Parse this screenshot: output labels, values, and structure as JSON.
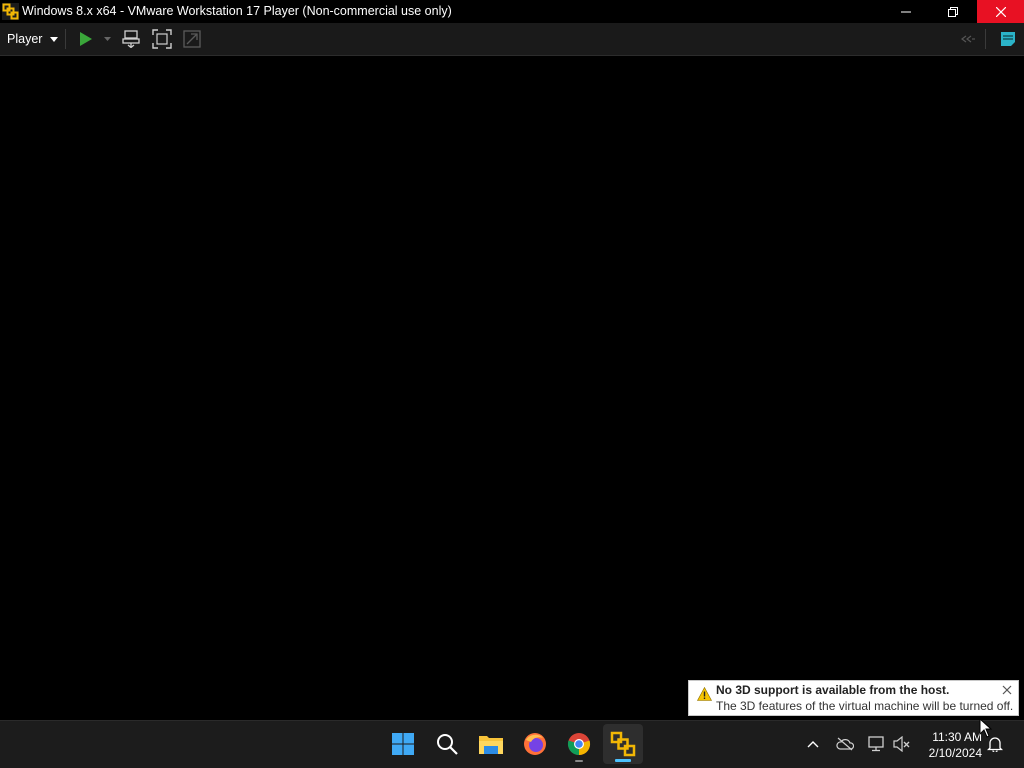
{
  "window": {
    "title": "Windows 8.x x64 - VMware Workstation 17 Player (Non-commercial use only)"
  },
  "toolbar": {
    "player_menu": "Player",
    "icons": [
      "play-icon",
      "play-dropdown-icon",
      "send-ctrl-alt-del-icon",
      "full-screen-icon",
      "unity-icon",
      "collapse-toolbar-icon",
      "message-log-icon"
    ]
  },
  "notification": {
    "title": "No 3D support is available from the host.",
    "message": "The 3D features of the virtual machine will be turned off.",
    "icon": "warning-icon"
  },
  "taskbar": {
    "apps": [
      "start-icon",
      "search-icon",
      "file-explorer-icon",
      "firefox-icon",
      "chrome-icon",
      "vmware-icon"
    ],
    "tray": [
      "show-hidden-icons-icon",
      "onedrive-offline-icon",
      "network-icon",
      "volume-muted-icon",
      "notification-bell-icon"
    ],
    "clock": {
      "time": "11:30 AM",
      "date": "2/10/2024"
    }
  },
  "colors": {
    "close_button": "#e81123",
    "accent": "#4cc2ff",
    "play_green": "#3aa63a"
  }
}
